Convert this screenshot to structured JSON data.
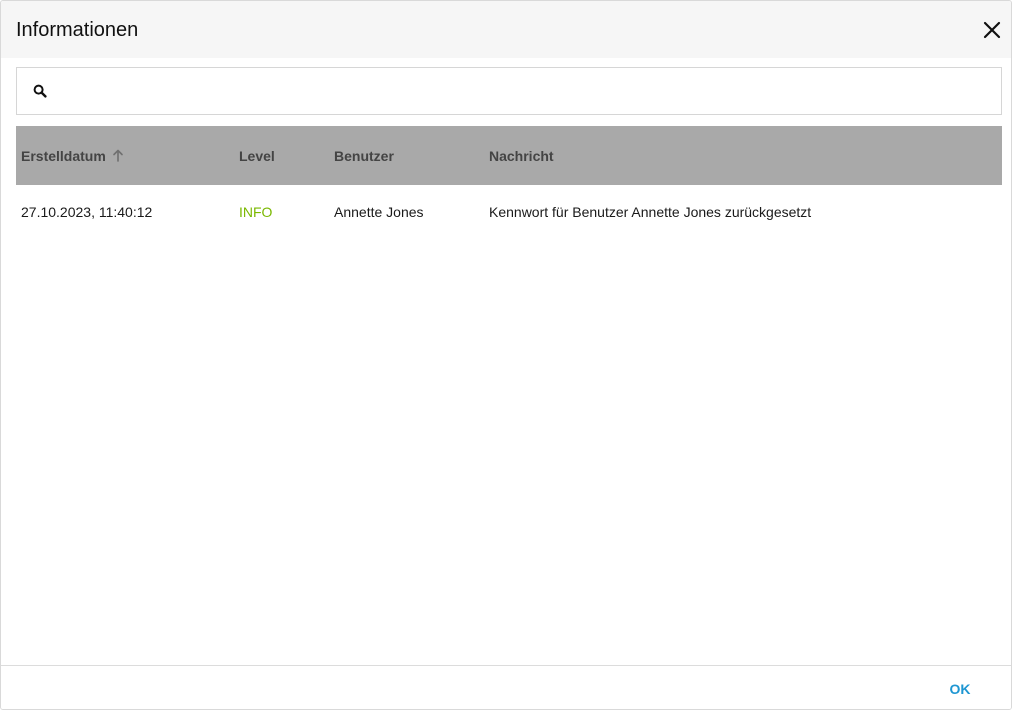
{
  "dialog": {
    "title": "Informationen"
  },
  "search": {
    "value": "",
    "placeholder": ""
  },
  "table": {
    "columns": [
      {
        "label": "Erstelldatum",
        "sorted": "ascending"
      },
      {
        "label": "Level"
      },
      {
        "label": "Benutzer"
      },
      {
        "label": "Nachricht"
      }
    ],
    "rows": [
      {
        "date": "27.10.2023, 11:40:12",
        "level": "INFO",
        "user": "Annette Jones",
        "message": "Kennwort für Benutzer Annette Jones zurückgesetzt"
      }
    ]
  },
  "footer": {
    "ok_label": "OK"
  },
  "colors": {
    "header_bg": "#f6f6f6",
    "grid_header_bg": "#a9a9a9",
    "level_info": "#7ab800",
    "accent": "#1e96d2"
  },
  "icons": {
    "close": "close-icon",
    "search": "search-icon",
    "sort": "sort-ascending-icon"
  }
}
